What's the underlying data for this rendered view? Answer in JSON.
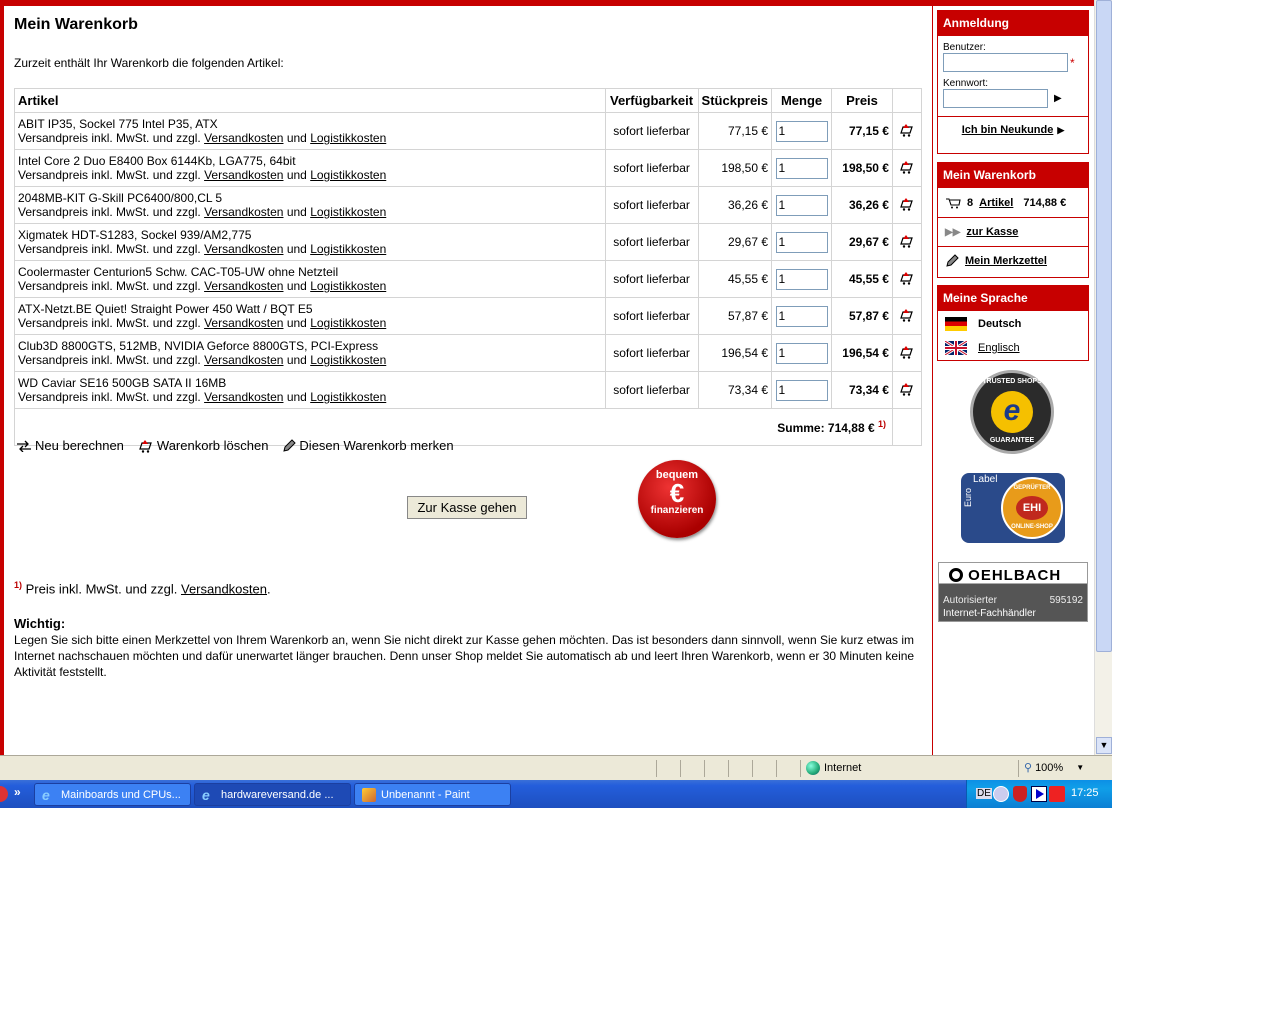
{
  "page": {
    "title": "Mein Warenkorb",
    "intro": "Zurzeit enthält Ihr Warenkorb die folgenden Artikel:"
  },
  "table": {
    "headers": [
      "Artikel",
      "Verfügbarkeit",
      "Stückpreis",
      "Menge",
      "Preis"
    ],
    "shipping_prefix": "Versandpreis inkl. MwSt. und zzgl.",
    "shipping_link": "Versandkosten",
    "and": "und",
    "logistics_link": "Logistikkosten",
    "rows": [
      {
        "name": "ABIT IP35, Sockel 775 Intel P35, ATX",
        "availability": "sofort lieferbar",
        "unit": "77,15 €",
        "qty": "1",
        "price": "77,15 €"
      },
      {
        "name": "Intel Core 2 Duo E8400 Box 6144Kb, LGA775, 64bit",
        "availability": "sofort lieferbar",
        "unit": "198,50 €",
        "qty": "1",
        "price": "198,50 €"
      },
      {
        "name": "2048MB-KIT G-Skill PC6400/800,CL 5",
        "availability": "sofort lieferbar",
        "unit": "36,26 €",
        "qty": "1",
        "price": "36,26 €"
      },
      {
        "name": "Xigmatek HDT-S1283, Sockel 939/AM2,775",
        "availability": "sofort lieferbar",
        "unit": "29,67 €",
        "qty": "1",
        "price": "29,67 €"
      },
      {
        "name": "Coolermaster Centurion5 Schw. CAC-T05-UW ohne Netzteil",
        "availability": "sofort lieferbar",
        "unit": "45,55 €",
        "qty": "1",
        "price": "45,55 €"
      },
      {
        "name": "ATX-Netzt.BE Quiet! Straight Power 450 Watt / BQT E5",
        "availability": "sofort lieferbar",
        "unit": "57,87 €",
        "qty": "1",
        "price": "57,87 €"
      },
      {
        "name": "Club3D 8800GTS, 512MB, NVIDIA Geforce 8800GTS, PCI-Express",
        "availability": "sofort lieferbar",
        "unit": "196,54 €",
        "qty": "1",
        "price": "196,54 €"
      },
      {
        "name": "WD Caviar SE16 500GB SATA II 16MB",
        "availability": "sofort lieferbar",
        "unit": "73,34 €",
        "qty": "1",
        "price": "73,34 €"
      }
    ],
    "sum": "Summe: 714,88 €",
    "sum_note": "1)"
  },
  "actions": {
    "recalc": "Neu berechnen",
    "clear": "Warenkorb löschen",
    "remember": "Diesen Warenkorb merken",
    "checkout": "Zur Kasse gehen"
  },
  "finance_badge": {
    "top": "bequem",
    "symbol": "€",
    "bottom": "finanzieren"
  },
  "footnote": {
    "mark": "1)",
    "text": "Preis inkl. MwSt. und zzgl.",
    "link": "Versandkosten",
    "end": "."
  },
  "important": {
    "heading": "Wichtig:",
    "text": "Legen Sie sich bitte einen Merkzettel von Ihrem Warenkorb an, wenn Sie nicht direkt zur Kasse gehen möchten. Das ist besonders dann sinnvoll, wenn Sie kurz etwas im Internet nachschauen möchten und dafür unerwartet länger brauchen. Denn unser Shop meldet Sie automatisch ab und leert Ihren Warenkorb, wenn er 30 Minuten keine Aktivität feststellt."
  },
  "sidebar": {
    "login": {
      "title": "Anmeldung",
      "user_label": "Benutzer:",
      "required": "*",
      "pass_label": "Kennwort:",
      "new_customer": "Ich bin Neukunde"
    },
    "cart": {
      "title": "Mein Warenkorb",
      "count": "8",
      "articles": "Artikel",
      "total": "714,88 €",
      "checkout": "zur Kasse",
      "wishlist": "Mein Merkzettel"
    },
    "language": {
      "title": "Meine Sprache",
      "german": "Deutsch",
      "english": "Englisch"
    },
    "trusted": {
      "line1": "TRUSTED SHOPS",
      "line2": "GUARANTEE"
    },
    "ehi": {
      "euro": "Euro",
      "label": "Label",
      "top": "GEPRÜFTER",
      "center": "EHI",
      "bottom": "ONLINE-SHOP"
    },
    "oehlbach": {
      "brand": "OEHLBACH",
      "line1": "Autorisierter",
      "number": "595192",
      "line2": "Internet-Fachhändler"
    }
  },
  "statusbar": {
    "zone": "Internet",
    "zoom": "100%"
  },
  "taskbar": {
    "tasks": [
      "Mainboards und CPUs...",
      "hardwareversand.de ...",
      "Unbenannt - Paint"
    ],
    "lang": "DE",
    "time": "17:25"
  },
  "colors": {
    "brand_red": "#c70000",
    "taskbar_blue": "#245edb"
  }
}
